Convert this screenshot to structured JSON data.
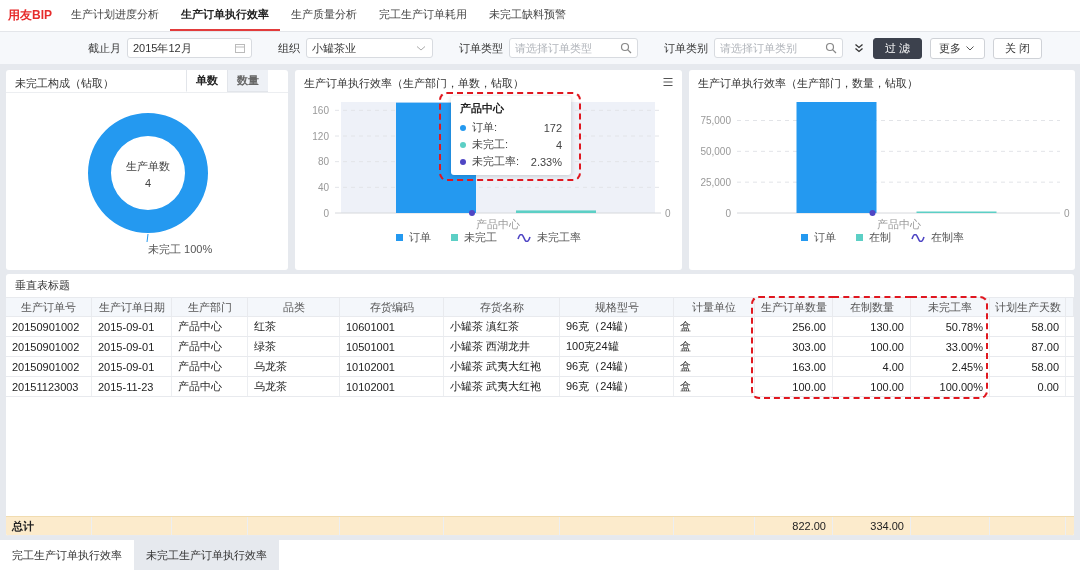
{
  "app": {
    "logo": "用友BIP"
  },
  "nav_tabs": [
    {
      "label": "生产计划进度分析",
      "selected": false
    },
    {
      "label": "生产订单执行效率",
      "selected": true
    },
    {
      "label": "生产质量分析",
      "selected": false
    },
    {
      "label": "完工生产订单耗用",
      "selected": false
    },
    {
      "label": "未完工缺料预警",
      "selected": false
    }
  ],
  "filters": [
    {
      "kind": "date",
      "label": "截止月",
      "value": "2015年12月"
    },
    {
      "kind": "select",
      "label": "组织",
      "value": "小罐茶业"
    },
    {
      "kind": "search",
      "label": "订单类型",
      "placeholder": "请选择订单类型"
    },
    {
      "kind": "search",
      "label": "订单类别",
      "placeholder": "请选择订单类别"
    }
  ],
  "filter_buttons": [
    {
      "label": "过 滤",
      "kind": "primary"
    },
    {
      "label": "更多",
      "kind": "dropdown"
    },
    {
      "label": "关 闭",
      "kind": "plain"
    }
  ],
  "composition_panel": {
    "title": "未完工构成（钻取）",
    "tabs": [
      {
        "label": "单数",
        "selected": true
      },
      {
        "label": "数量",
        "selected": false
      }
    ],
    "center_label": "生产单数",
    "center_value": "4",
    "chart_data": {
      "type": "pie",
      "categories": [
        "未完工"
      ],
      "values": [
        100
      ],
      "value_labels": [
        "100%"
      ],
      "colors": [
        "#2499f0"
      ]
    }
  },
  "efficiency_panels": [
    {
      "title": "生产订单执行效率（生产部门，单数，钻取）",
      "menu": true,
      "secondary_axis_labels": [
        "0"
      ],
      "tooltip": {
        "title": "产品中心",
        "highlighted": true,
        "rows": [
          {
            "label": "订单:",
            "value": "172",
            "color": "#2499f0"
          },
          {
            "label": "未完工:",
            "value": "4",
            "color": "#5ccfc5"
          },
          {
            "label": "未完工率:",
            "value": "2.33%",
            "color": "#4f46c4"
          }
        ]
      },
      "chart_data": {
        "type": "bar",
        "categories": [
          "产品中心"
        ],
        "ylim": [
          0,
          173
        ],
        "yticks": [
          0,
          40,
          80,
          120,
          160
        ],
        "grid": true,
        "legend": true,
        "series": [
          {
            "name": "订单",
            "type": "bar",
            "color": "#2499f0",
            "values": [
              172
            ]
          },
          {
            "name": "未完工",
            "type": "bar",
            "color": "#5ccfc5",
            "values": [
              4
            ]
          },
          {
            "name": "未完工率",
            "type": "line",
            "color": "#4f46c4",
            "marker": "circle",
            "values": [
              0
            ]
          }
        ]
      }
    },
    {
      "title": "生产订单执行效率（生产部门，数量，钻取）",
      "menu": false,
      "secondary_axis_labels": [
        "0"
      ],
      "chart_data": {
        "type": "bar",
        "categories": [
          "产品中心"
        ],
        "ylim": [
          0,
          90000
        ],
        "yticks": [
          {
            "value": 0,
            "label": "0"
          },
          {
            "value": 25000,
            "label": "25,000"
          },
          {
            "value": 50000,
            "label": "50,000"
          },
          {
            "value": 75000,
            "label": "75,000"
          }
        ],
        "grid": true,
        "legend": true,
        "series": [
          {
            "name": "订单",
            "type": "bar",
            "color": "#2499f0",
            "values": [
              90000
            ]
          },
          {
            "name": "在制",
            "type": "bar",
            "color": "#5ccfc5",
            "values": [
              0
            ]
          },
          {
            "name": "在制率",
            "type": "line",
            "color": "#4f46c4",
            "marker": "circle",
            "values": [
              0
            ]
          }
        ]
      }
    }
  ],
  "table": {
    "title": "垂直表标题",
    "columns": [
      {
        "label": "生产订单号",
        "kind": "text",
        "highlighted": false
      },
      {
        "label": "生产订单日期",
        "kind": "text",
        "highlighted": false
      },
      {
        "label": "生产部门",
        "kind": "text",
        "highlighted": false
      },
      {
        "label": "品类",
        "kind": "text",
        "highlighted": false
      },
      {
        "label": "存货编码",
        "kind": "text",
        "highlighted": false
      },
      {
        "label": "存货名称",
        "kind": "text",
        "highlighted": false
      },
      {
        "label": "规格型号",
        "kind": "text",
        "highlighted": false
      },
      {
        "label": "计量单位",
        "kind": "text",
        "highlighted": false
      },
      {
        "label": "生产订单数量",
        "kind": "number",
        "highlighted": true
      },
      {
        "label": "在制数量",
        "kind": "number",
        "highlighted": true
      },
      {
        "label": "未完工率",
        "kind": "number",
        "highlighted": true
      },
      {
        "label": "计划生产天数",
        "kind": "number",
        "highlighted": false
      }
    ],
    "rows": [
      [
        "20150901002",
        "2015-09-01",
        "产品中心",
        "红茶",
        "10601001",
        "小罐茶 滇红茶",
        "96克（24罐）",
        "盒",
        "256.00",
        "130.00",
        "50.78%",
        "58.00"
      ],
      [
        "20150901002",
        "2015-09-01",
        "产品中心",
        "绿茶",
        "10501001",
        "小罐茶 西湖龙井",
        "100克24罐",
        "盒",
        "303.00",
        "100.00",
        "33.00%",
        "87.00"
      ],
      [
        "20150901002",
        "2015-09-01",
        "产品中心",
        "乌龙茶",
        "10102001",
        "小罐茶 武夷大红袍",
        "96克（24罐）",
        "盒",
        "163.00",
        "4.00",
        "2.45%",
        "58.00"
      ],
      [
        "20151123003",
        "2015-11-23",
        "产品中心",
        "乌龙茶",
        "10102001",
        "小罐茶 武夷大红袍",
        "96克（24罐）",
        "盒",
        "100.00",
        "100.00",
        "100.00%",
        "0.00"
      ]
    ],
    "totals": [
      {
        "kind": "label",
        "text": "总计"
      },
      {
        "kind": "blank"
      },
      {
        "kind": "blank"
      },
      {
        "kind": "blank"
      },
      {
        "kind": "blank"
      },
      {
        "kind": "blank"
      },
      {
        "kind": "blank"
      },
      {
        "kind": "blank"
      },
      {
        "kind": "value",
        "text": "822.00"
      },
      {
        "kind": "value",
        "text": "334.00"
      },
      {
        "kind": "blank"
      },
      {
        "kind": "blank"
      }
    ]
  },
  "bottom_tabs": [
    {
      "label": "完工生产订单执行效率",
      "selected": false
    },
    {
      "label": "未完工生产订单执行效率",
      "selected": true
    }
  ]
}
